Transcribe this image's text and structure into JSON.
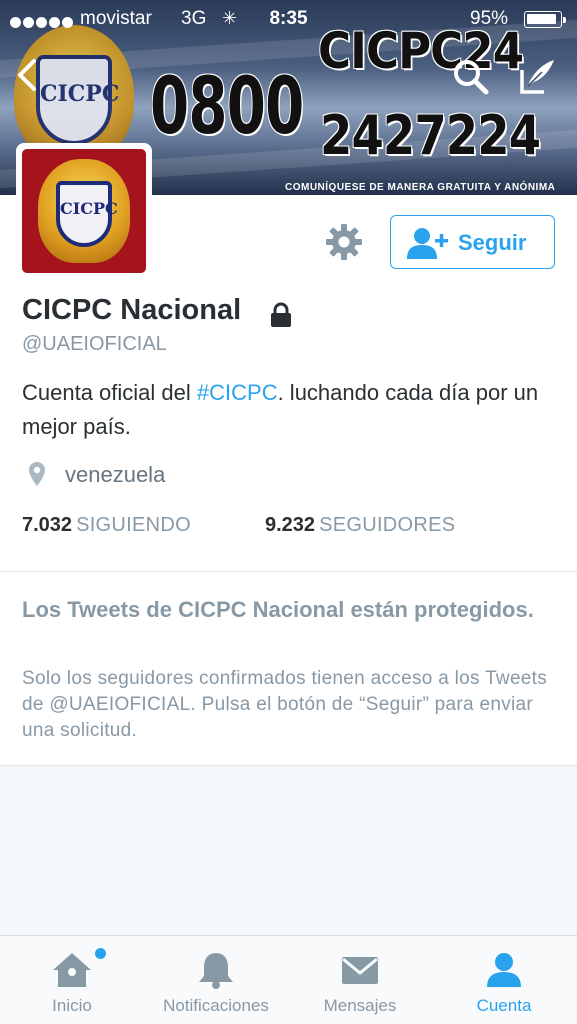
{
  "status_bar": {
    "carrier": "movistar",
    "network": "3G",
    "time": "8:35",
    "battery_percent": "95%",
    "battery_level": 0.95
  },
  "banner": {
    "phone_prefix": "0800",
    "brand": "CICPC24",
    "phone_number": "2427224",
    "footer": "COMUNÍQUESE DE MANERA GRATUITA Y ANÓNIMA",
    "shield_text": "CICPC"
  },
  "profile": {
    "name": "CICPC Nacional",
    "handle": "@UAEIOFICIAL",
    "bio_prefix": "Cuenta oficial del ",
    "bio_hashtag": "#CICPC",
    "bio_suffix": ". luchando cada día por un mejor país.",
    "location": "venezuela",
    "following_count": "7.032",
    "following_label": "SIGUIENDO",
    "followers_count": "9.232",
    "followers_label": "SEGUIDORES",
    "avatar_text": "CICPC"
  },
  "actions": {
    "follow_label": "Seguir"
  },
  "protected": {
    "title": "Los Tweets de CICPC Nacional están protegidos.",
    "description": "Solo los seguidores confirmados tienen acceso a los Tweets de @UAEIOFICIAL. Pulsa el botón de “Seguir” para enviar una solicitud."
  },
  "tabbar": {
    "home": "Inicio",
    "notifications": "Notificaciones",
    "messages": "Mensajes",
    "account": "Cuenta"
  },
  "colors": {
    "accent": "#2aa3ef",
    "muted": "#8899a6",
    "text": "#292f33",
    "avatar_bg": "#a5131d"
  }
}
